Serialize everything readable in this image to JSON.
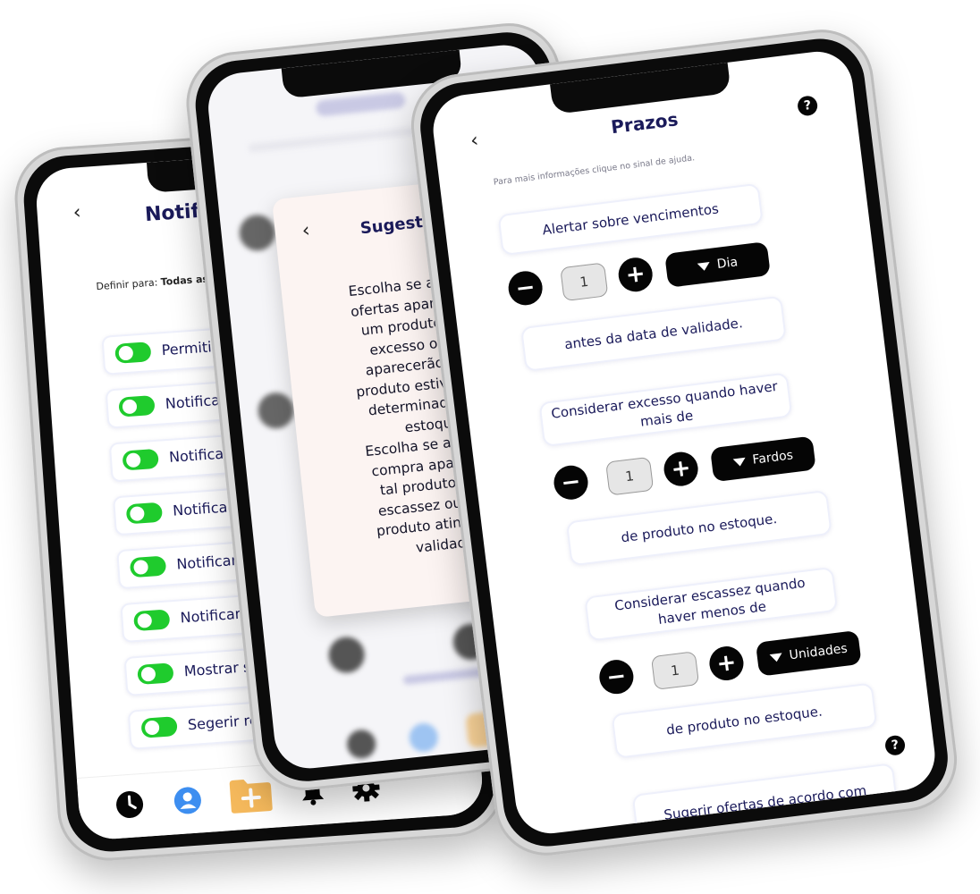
{
  "left": {
    "title": "Notifica",
    "define_label": "Definir para: ",
    "define_value": "Todas as Listas",
    "toggles": [
      "Permitir notifi",
      "Notificar exco",
      "Notificar exce",
      "Notificar vali",
      "Notificar entr",
      "Notificar saíd",
      "Mostrar suge",
      "Segerir reabo"
    ]
  },
  "middle": {
    "popup_title": "Sugestões",
    "popup_lines": [
      "Escolha se as sugest",
      "ofertas aparecerão c",
      "um produto estive",
      "excesso ou se el",
      "aparecerão quand",
      "produto estiver parac",
      "determinado temp",
      "estoque.",
      "Escolha se as sugest",
      "compra aparecerão",
      "tal produto estive",
      "escassez ou quanc",
      "produto atingir a da",
      "validade."
    ]
  },
  "right": {
    "title": "Prazos",
    "help_glyph": "?",
    "subtitle": "Para mais informações clique no sinal de ajuda.",
    "alert_card": "Alertar sobre vencimentos",
    "stepper1": {
      "minus": "−",
      "value": "1",
      "plus": "+",
      "unit": "Dia"
    },
    "after_card1": "antes da data de validade.",
    "excess_card": "Considerar excesso quando haver mais de",
    "stepper2": {
      "minus": "−",
      "value": "1",
      "plus": "+",
      "unit": "Fardos"
    },
    "after_card2": "de produto no estoque.",
    "scarcity_card": "Considerar escassez quando haver menos de",
    "stepper3": {
      "minus": "−",
      "value": "1",
      "plus": "+",
      "unit": "Unidades"
    },
    "after_card3": "de produto no estoque.",
    "offers_card": "Sugerir ofertas de acordo com"
  },
  "colors": {
    "title_navy": "#1a1a5a",
    "toggle_green": "#1fcb2d",
    "popup_bg": "#fcf4f2",
    "folder_orange": "#f5b95c",
    "profile_blue": "#3d8ef0"
  }
}
